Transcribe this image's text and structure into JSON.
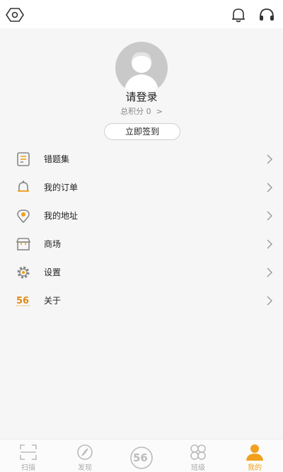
{
  "topbar": {
    "left_icon": "hexagon-eye-icon",
    "right_icons": [
      "bell-icon",
      "headset-icon"
    ]
  },
  "profile": {
    "login_text": "请登录",
    "points_text": "总积分 0",
    "checkin_button": "立即签到"
  },
  "menu": [
    {
      "label": "错题集",
      "icon": "notebook-icon"
    },
    {
      "label": "我的订单",
      "icon": "bell-icon"
    },
    {
      "label": "我的地址",
      "icon": "location-icon"
    },
    {
      "label": "商场",
      "icon": "store-icon"
    },
    {
      "label": "设置",
      "icon": "gear-icon"
    },
    {
      "label": "关于",
      "icon": "logo-56-icon"
    }
  ],
  "tabbar": [
    {
      "label": "扫描",
      "icon": "scan-icon"
    },
    {
      "label": "发现",
      "icon": "compass-icon"
    },
    {
      "label": "",
      "icon": "logo-56-icon"
    },
    {
      "label": "班级",
      "icon": "grid-circles-icon"
    },
    {
      "label": "我的",
      "icon": "person-icon",
      "active": true
    }
  ],
  "colors": {
    "accent": "#f1a11d",
    "icon_gray": "#888888",
    "background": "#f6f6f6"
  }
}
